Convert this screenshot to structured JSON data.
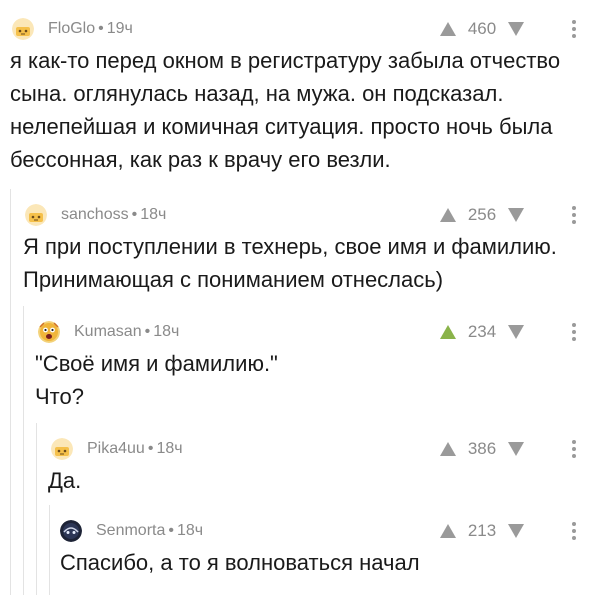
{
  "comments": [
    {
      "author": "FloGlo",
      "time": "19ч",
      "rating": "460",
      "up_active": false,
      "avatar": "default-face-icon",
      "text": "я как-то перед окном в регистратуру забыла отчество\nсына. оглянулась назад, на мужа. он подсказал.\nнелепейшая и комичная ситуация. просто ночь была\nбессонная, как раз к врачу его везли."
    },
    {
      "author": "sanchoss",
      "time": "18ч",
      "rating": "256",
      "up_active": false,
      "avatar": "default-face-icon",
      "text": "Я при поступлении в технерь, свое имя и фамилию.\nПринимающая с пониманием отнеслась)"
    },
    {
      "author": "Kumasan",
      "time": "18ч",
      "rating": "234",
      "up_active": true,
      "avatar": "shocked-face-icon",
      "text": "\"Своё имя и фамилию.\"\nЧто?"
    },
    {
      "author": "Pika4uu",
      "time": "18ч",
      "rating": "386",
      "up_active": false,
      "avatar": "default-face-icon",
      "text": "Да."
    },
    {
      "author": "Senmorta",
      "time": "18ч",
      "rating": "213",
      "up_active": false,
      "avatar": "dark-character-icon",
      "text": "Спасибо, а то я волноваться начал"
    }
  ],
  "colors": {
    "meta": "#8a8a8a",
    "arrow": "#9a9a9a",
    "arrow_active": "#8ab34a",
    "thread_line": "#e3e3e3"
  }
}
